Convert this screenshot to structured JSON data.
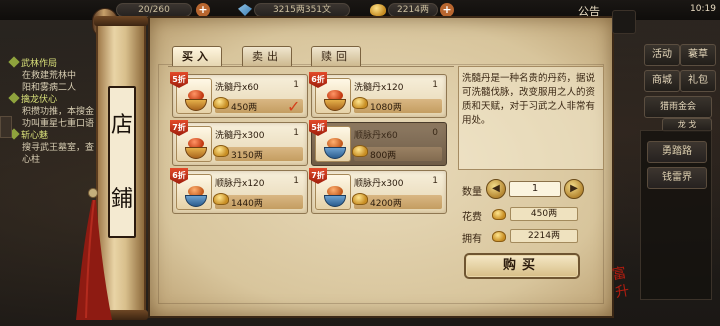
{
  "topbar": {
    "stamina": "20/260",
    "silver": "3215两351文",
    "gold": "2214两",
    "notice": "公告",
    "time": "10:19"
  },
  "quest": {
    "items": [
      {
        "title": "武林作局",
        "body": [
          "在救建荒林中",
          "阳和雾病二人"
        ]
      },
      {
        "title": "擒龙伏心",
        "body": [
          "积攒功推，本搜金",
          "功叫重星七重口语"
        ]
      },
      {
        "title": "斩心魅",
        "body": [
          "搜寻武王墓室，查",
          "心柱"
        ]
      }
    ]
  },
  "side_menu": {
    "buttons": [
      "活动",
      "蓑草",
      "商城",
      "礼包",
      "猎雨金会",
      "龙 戈"
    ],
    "panel_items": [
      "勇踏路",
      "钱雷界"
    ]
  },
  "scroll": {
    "label_chars": [
      "店",
      "鋪"
    ]
  },
  "tabs": [
    "买入",
    "卖出",
    "赎回"
  ],
  "items": [
    {
      "name": "洗髓丹x60",
      "count": "1",
      "price": "450两",
      "discount": "5折",
      "type": "red",
      "selected": false,
      "checked": true
    },
    {
      "name": "洗髓丹x120",
      "count": "1",
      "price": "1080两",
      "discount": "6折",
      "type": "red",
      "selected": false,
      "checked": false
    },
    {
      "name": "洗髓丹x300",
      "count": "1",
      "price": "3150两",
      "discount": "7折",
      "type": "red",
      "selected": false,
      "checked": false
    },
    {
      "name": "顺脉丹x60",
      "count": "0",
      "price": "800两",
      "discount": "5折",
      "type": "blue",
      "selected": true,
      "checked": false
    },
    {
      "name": "顺脉丹x120",
      "count": "1",
      "price": "1440两",
      "discount": "6折",
      "type": "blue",
      "selected": false,
      "checked": false
    },
    {
      "name": "顺脉丹x300",
      "count": "1",
      "price": "4200两",
      "discount": "7折",
      "type": "blue",
      "selected": false,
      "checked": false
    }
  ],
  "description": "洗髓丹是一种名贵的丹药，据说可洗髓伐脉，改变服用之人的资质和天赋，对于习武之人非常有用处。",
  "purchase": {
    "qty_label": "数量",
    "qty": "1",
    "cost_label": "花费",
    "cost": "450两",
    "own_label": "拥有",
    "own": "2214两",
    "buy_label": "购买"
  },
  "seal_text": "富升"
}
